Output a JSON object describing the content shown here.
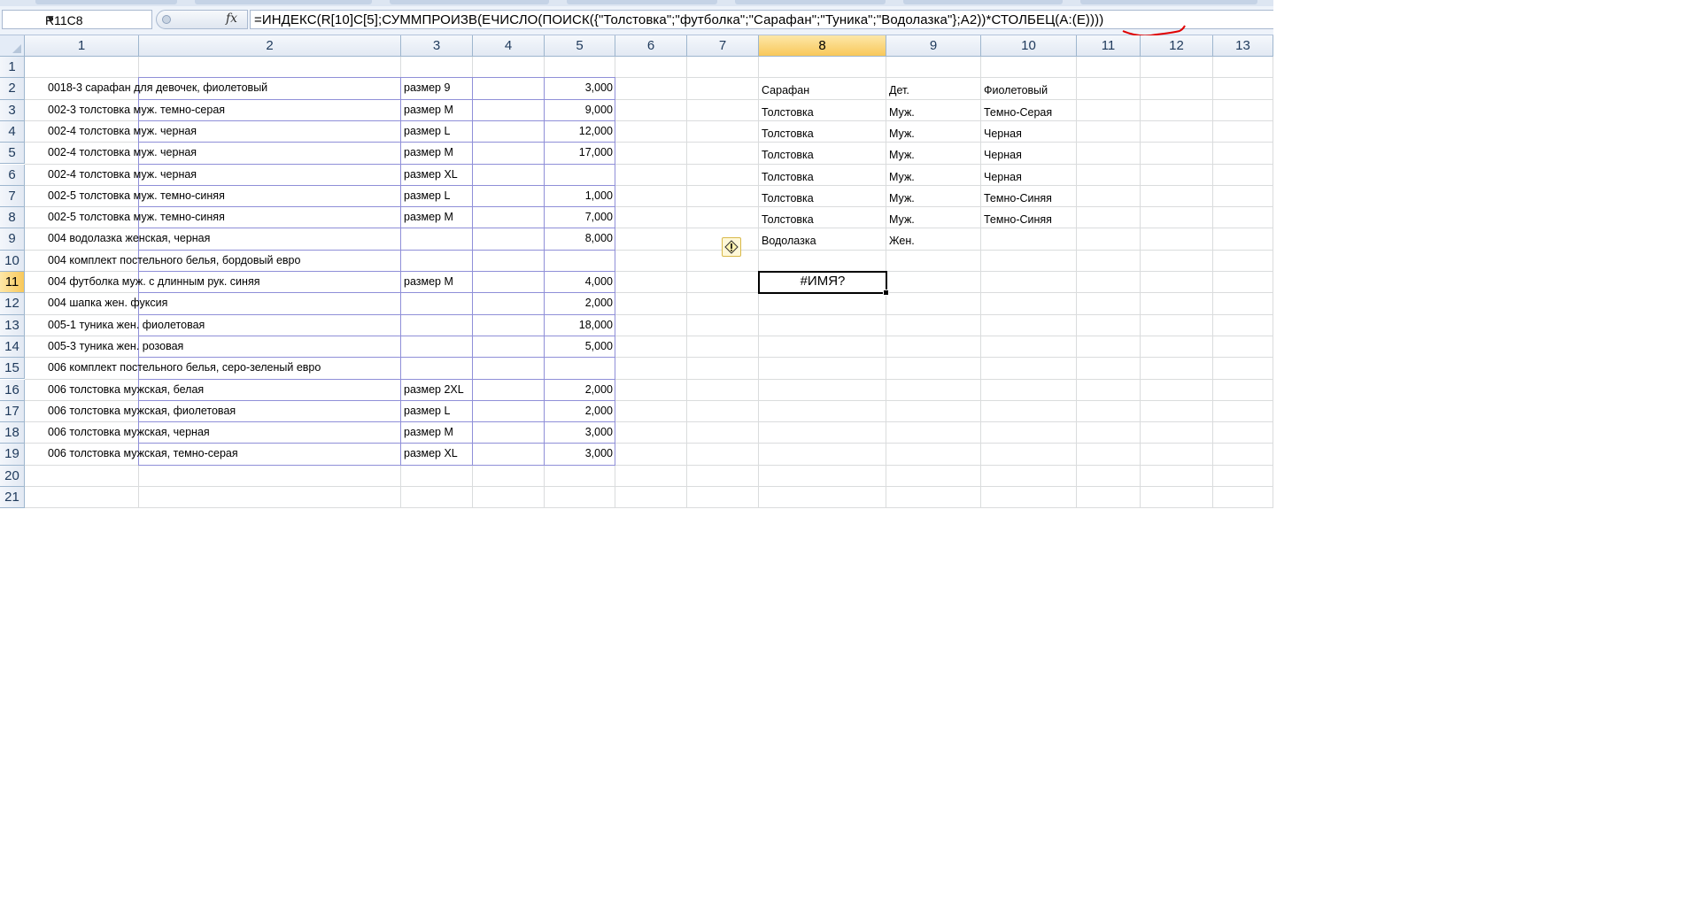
{
  "name_box": "R11C8",
  "formula": "=ИНДЕКС(R[10]C[5];СУММПРОИЗВ(ЕЧИСЛО(ПОИСК({\"Толстовка\";\"футболка\";\"Сарафан\";\"Туника\";\"Водолазка\"};A2))*СТОЛБЕЦ(A:(E))))",
  "column_headers": [
    "1",
    "2",
    "3",
    "4",
    "5",
    "6",
    "7",
    "8",
    "9",
    "10",
    "11",
    "12",
    "13"
  ],
  "row_headers": [
    "1",
    "2",
    "3",
    "4",
    "5",
    "6",
    "7",
    "8",
    "9",
    "10",
    "11",
    "12",
    "13",
    "14",
    "15",
    "16",
    "17",
    "18",
    "19",
    "20",
    "21"
  ],
  "selected_column": "8",
  "selected_row": "11",
  "table": [
    {
      "name": "0018-3 сарафан для девочек, фиолетовый",
      "size": "размер 9",
      "qty": "3,000"
    },
    {
      "name": "002-3 толстовка муж. темно-серая",
      "size": "размер M",
      "qty": "9,000"
    },
    {
      "name": "002-4 толстовка муж. черная",
      "size": "размер L",
      "qty": "12,000"
    },
    {
      "name": "002-4 толстовка муж. черная",
      "size": "размер M",
      "qty": "17,000"
    },
    {
      "name": "002-4 толстовка муж. черная",
      "size": "размер XL",
      "qty": ""
    },
    {
      "name": "002-5 толстовка муж. темно-синяя",
      "size": "размер L",
      "qty": "1,000"
    },
    {
      "name": "002-5 толстовка муж. темно-синяя",
      "size": "размер M",
      "qty": "7,000"
    },
    {
      "name": "004 водолазка женская, черная",
      "size": "",
      "qty": "8,000"
    },
    {
      "name": "004 комплект постельного белья, бордовый евро",
      "size": "",
      "qty": ""
    },
    {
      "name": "004 футболка муж. с длинным рук. синяя",
      "size": "размер M",
      "qty": "4,000"
    },
    {
      "name": "004 шапка жен. фуксия",
      "size": "",
      "qty": "2,000"
    },
    {
      "name": "005-1 туника жен. фиолетовая",
      "size": "",
      "qty": "18,000"
    },
    {
      "name": "005-3 туника жен. розовая",
      "size": "",
      "qty": "5,000"
    },
    {
      "name": "006 комплект постельного белья, серо-зеленый евро",
      "size": "",
      "qty": ""
    },
    {
      "name": "006 толстовка мужская, белая",
      "size": "размер 2XL",
      "qty": "2,000"
    },
    {
      "name": "006 толстовка мужская,  фиолетовая",
      "size": "размер L",
      "qty": "2,000"
    },
    {
      "name": "006 толстовка мужская, черная",
      "size": "размер M",
      "qty": "3,000"
    },
    {
      "name": "006 толстовка мужская, темно-серая",
      "size": "размер XL",
      "qty": "3,000"
    }
  ],
  "lookup": [
    {
      "type": "Сарафан",
      "gender": "Дет.",
      "color": "Фиолетовый"
    },
    {
      "type": "Толстовка",
      "gender": "Муж.",
      "color": "Темно-Серая"
    },
    {
      "type": "Толстовка",
      "gender": "Муж.",
      "color": "Черная"
    },
    {
      "type": "Толстовка",
      "gender": "Муж.",
      "color": "Черная"
    },
    {
      "type": "Толстовка",
      "gender": "Муж.",
      "color": "Черная"
    },
    {
      "type": "Толстовка",
      "gender": "Муж.",
      "color": "Темно-Синяя"
    },
    {
      "type": "Толстовка",
      "gender": "Муж.",
      "color": "Темно-Синяя"
    },
    {
      "type": "Водолазка",
      "gender": "Жен.",
      "color": ""
    }
  ],
  "active_cell_value": "#ИМЯ?",
  "icons": {
    "error_indicator": "warning-diamond-icon",
    "insert_function": "fx-icon",
    "namebox_dropdown": "chevron-down-icon"
  },
  "colors": {
    "selected_header": "#f8c85a",
    "table_border": "#8f8fd8",
    "annotation": "#e00000"
  }
}
